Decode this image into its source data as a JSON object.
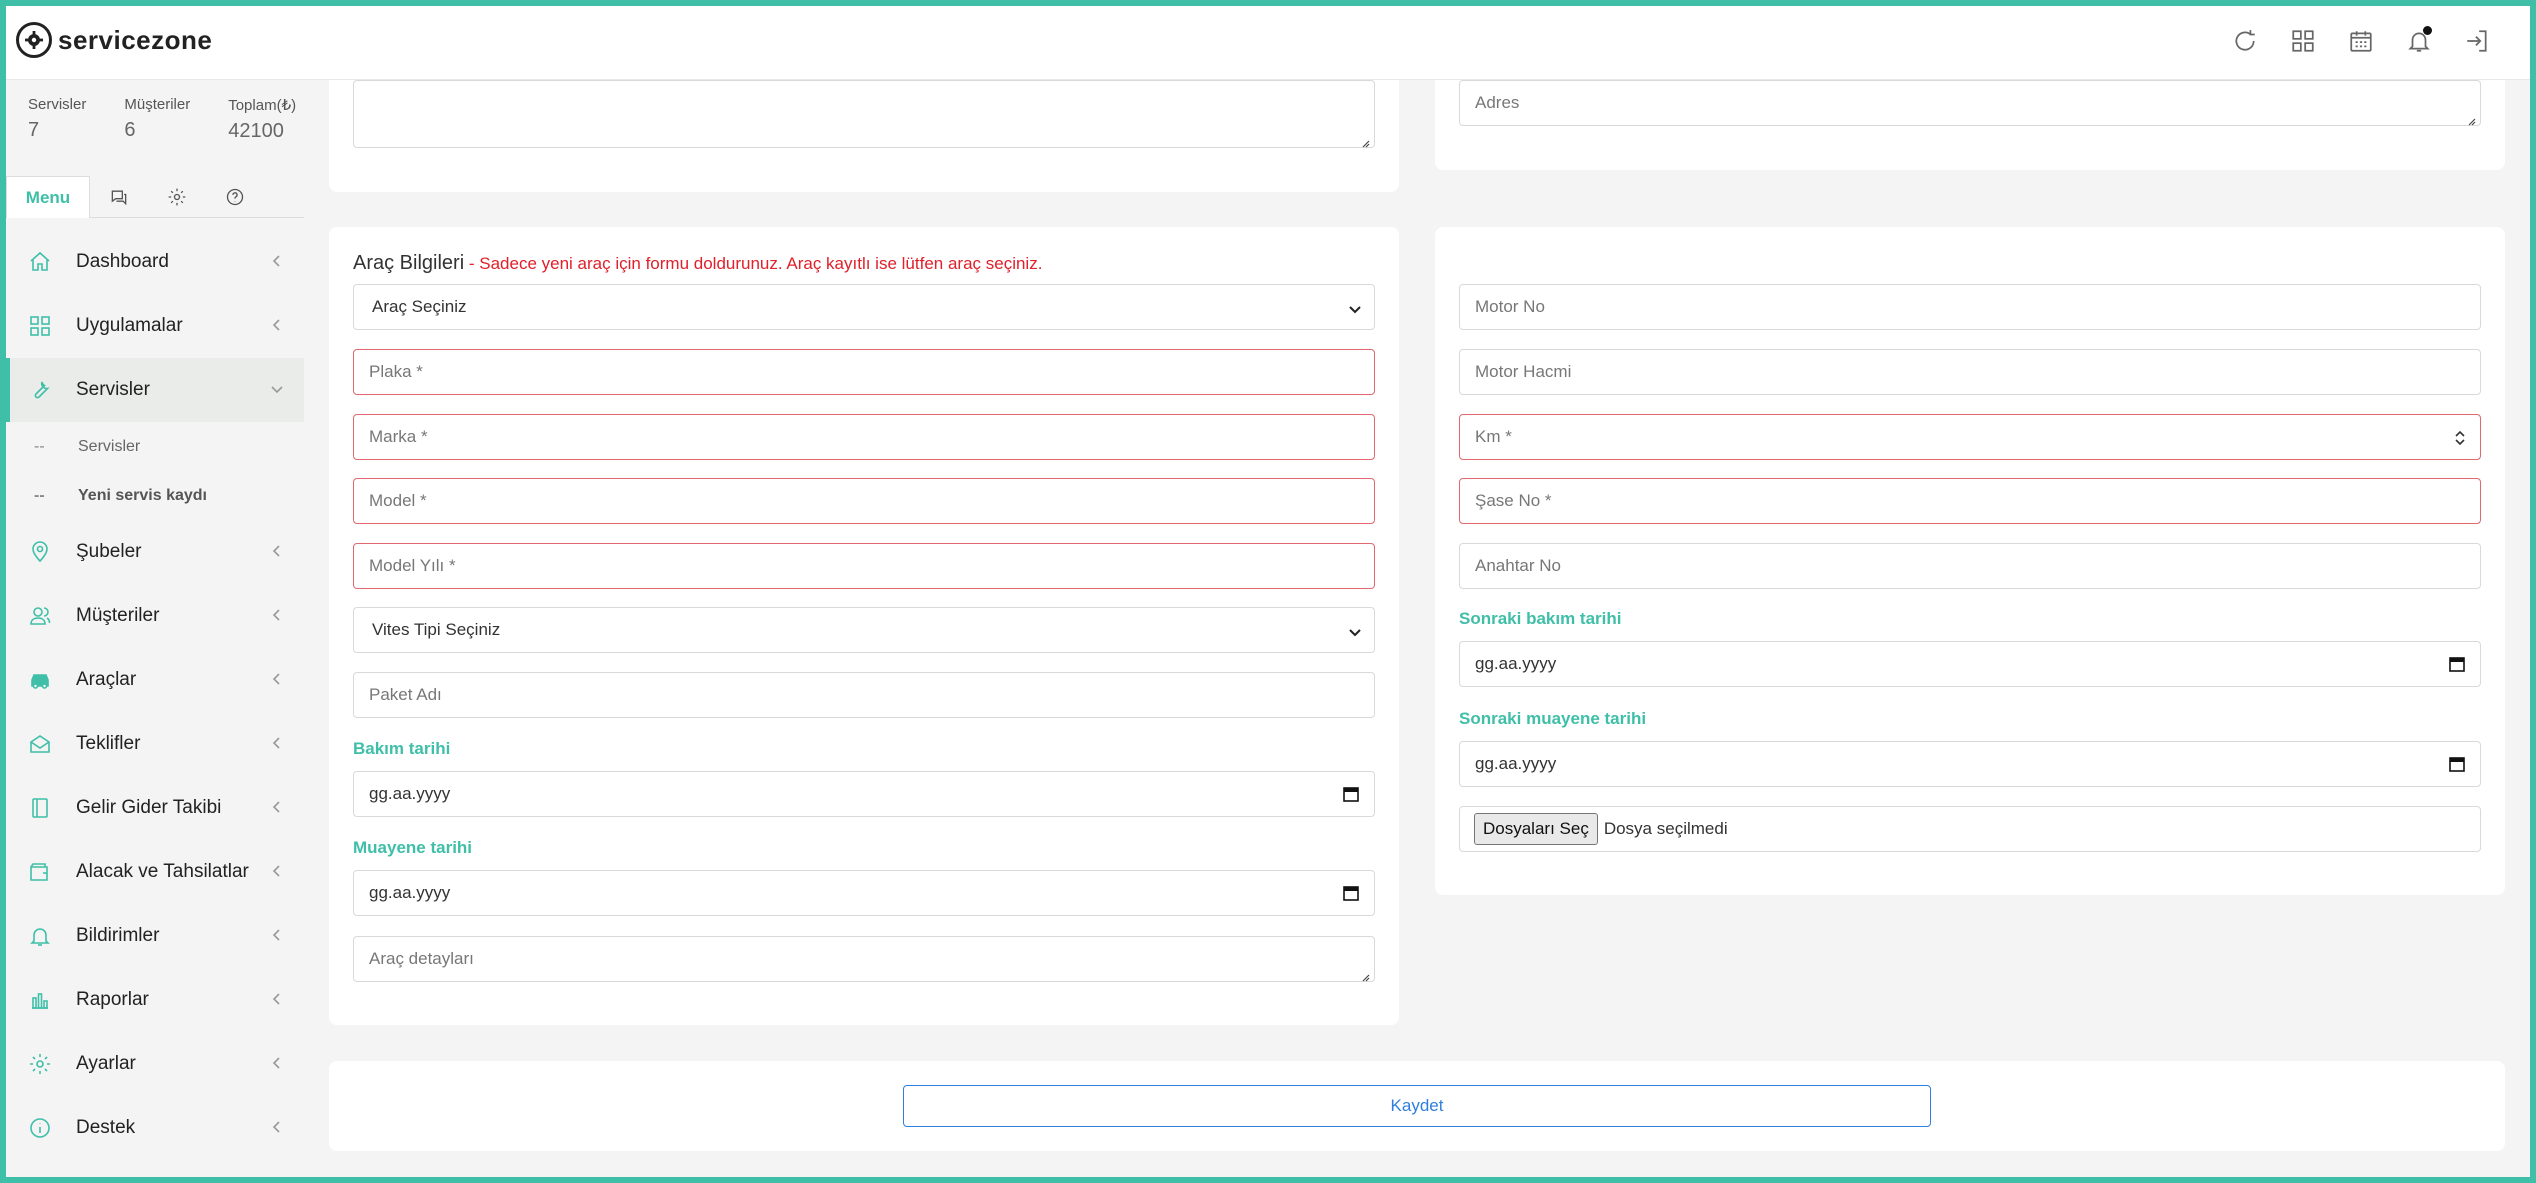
{
  "app": {
    "brand": "servicezone"
  },
  "topbar": {
    "icons": [
      "refresh-icon",
      "grid-icon",
      "calendar-icon",
      "bell-icon",
      "logout-icon"
    ]
  },
  "stats": [
    {
      "label": "Servisler",
      "value": "7"
    },
    {
      "label": "Müşteriler",
      "value": "6"
    },
    {
      "label": "Toplam(₺)",
      "value": "42100"
    }
  ],
  "menu": {
    "active_tab": "Menu"
  },
  "nav": {
    "dashboard": "Dashboard",
    "uygulamalar": "Uygulamalar",
    "servisler": "Servisler",
    "sub_servisler": "Servisler",
    "sub_yeni": "Yeni servis kaydı",
    "sub_dash": "--",
    "subeler": "Şubeler",
    "musteriler": "Müşteriler",
    "araclar": "Araçlar",
    "teklifler": "Teklifler",
    "gelir": "Gelir Gider Takibi",
    "alacak": "Alacak ve Tahsilatlar",
    "bildirimler": "Bildirimler",
    "raporlar": "Raporlar",
    "ayarlar": "Ayarlar",
    "destek": "Destek"
  },
  "top_form": {
    "adres_placeholder": "Adres"
  },
  "vehicle": {
    "title": "Araç Bilgileri",
    "warning": " - Sadece yeni araç için formu doldurunuz. Araç kayıtlı ise lütfen araç seçiniz.",
    "select_vehicle": "Araç Seçiniz",
    "plaka": "Plaka *",
    "marka": "Marka *",
    "model": "Model *",
    "model_yili": "Model Yılı *",
    "vites": "Vites Tipi Seçiniz",
    "paket": "Paket Adı",
    "bakim_label": "Bakım tarihi",
    "bakim_value": "gg.aa.yyyy",
    "muayene_label": "Muayene tarihi",
    "muayene_value": "gg.aa.yyyy",
    "detay": "Araç detayları"
  },
  "engine": {
    "motor_no": "Motor No",
    "motor_hacmi": "Motor Hacmi",
    "km": "Km *",
    "sase": "Şase No *",
    "anahtar": "Anahtar No",
    "sonraki_bakim_label": "Sonraki bakım tarihi",
    "sonraki_bakim_value": "gg.aa.yyyy",
    "sonraki_muayene_label": "Sonraki muayene tarihi",
    "sonraki_muayene_value": "gg.aa.yyyy",
    "file_button": "Dosyaları Seç",
    "file_status": "Dosya seçilmedi"
  },
  "actions": {
    "save": "Kaydet"
  },
  "colors": {
    "accent": "#3fbfa8",
    "required": "#e2676f",
    "warning": "#e0202a",
    "primary": "#2f7fe0"
  }
}
